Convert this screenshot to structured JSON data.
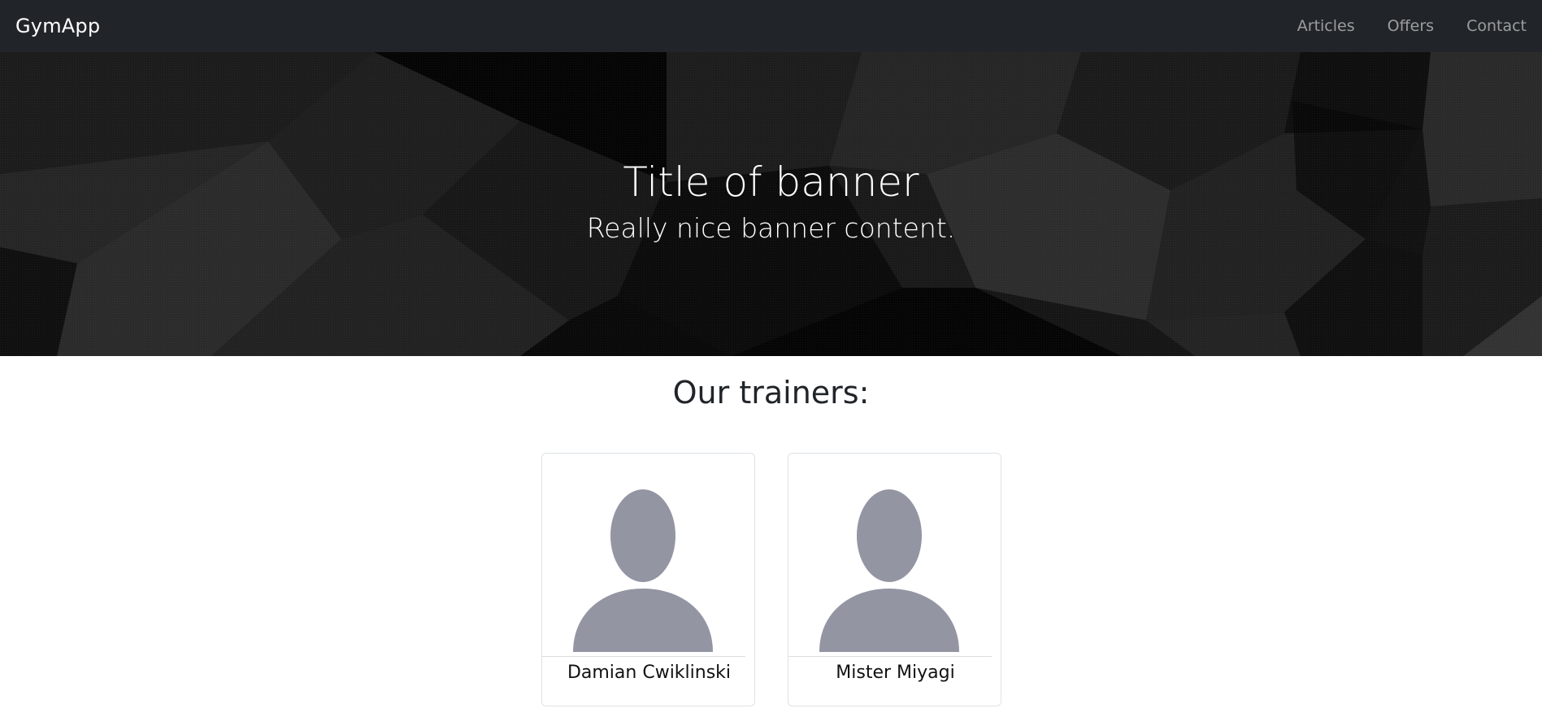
{
  "navbar": {
    "brand": "GymApp",
    "links": [
      {
        "label": "Articles"
      },
      {
        "label": "Offers"
      },
      {
        "label": "Contact"
      }
    ]
  },
  "banner": {
    "title": "Title of banner",
    "subtitle": "Really nice banner content."
  },
  "trainers": {
    "heading": "Our trainers:",
    "items": [
      {
        "name": "Damian Cwiklinski",
        "icon": "person-icon"
      },
      {
        "name": "Mister Miyagi",
        "icon": "person-icon"
      }
    ]
  },
  "colors": {
    "navbar_bg": "#212529",
    "nav_link": "#8c8f93",
    "avatar": "#9395a3"
  }
}
